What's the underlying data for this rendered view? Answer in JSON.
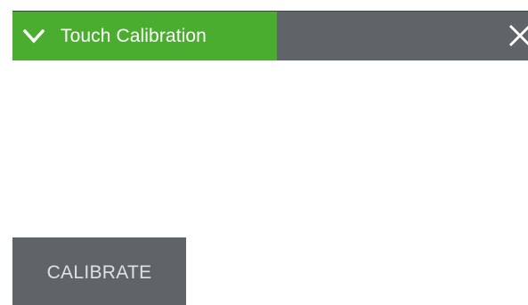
{
  "panel": {
    "title": "Touch Calibration",
    "expand_icon": "chevron-down-icon",
    "close_icon": "close-icon"
  },
  "actions": {
    "calibrate_label": "CALIBRATE"
  },
  "colors": {
    "header_active": "#4aad2f",
    "header_bar": "#5e6467",
    "button_bg": "#5e6467",
    "button_text": "#dfe2e3",
    "title_text": "#ffffff",
    "background": "#ffffff"
  }
}
